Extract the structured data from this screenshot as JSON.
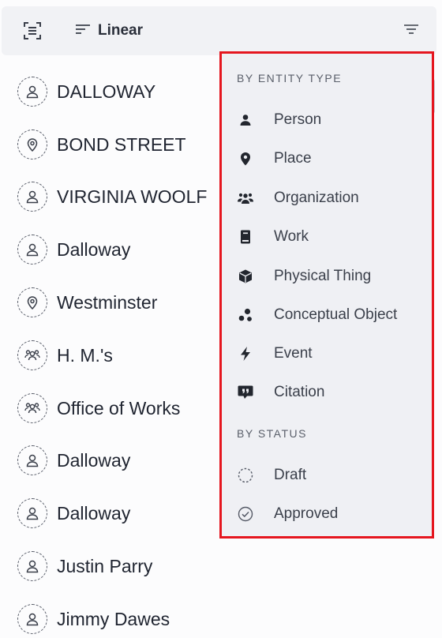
{
  "toolbar": {
    "layout_label": "Linear",
    "left_icon": "scan-text-icon",
    "sort_icon": "sort-lines-icon",
    "filter_icon": "filter-icon"
  },
  "entities": [
    {
      "label": "DALLOWAY",
      "type": "person"
    },
    {
      "label": "BOND STREET",
      "type": "place"
    },
    {
      "label": "VIRGINIA WOOLF",
      "type": "person"
    },
    {
      "label": "Dalloway",
      "type": "person"
    },
    {
      "label": "Westminster",
      "type": "place"
    },
    {
      "label": "H. M.'s",
      "type": "organization"
    },
    {
      "label": "Office of Works",
      "type": "organization"
    },
    {
      "label": "Dalloway",
      "type": "person"
    },
    {
      "label": "Dalloway",
      "type": "person"
    },
    {
      "label": "Justin Parry",
      "type": "person"
    },
    {
      "label": "Jimmy Dawes",
      "type": "person"
    }
  ],
  "filter_menu": {
    "entity_type_heading": "BY ENTITY TYPE",
    "entity_types": [
      {
        "label": "Person",
        "icon": "person-icon"
      },
      {
        "label": "Place",
        "icon": "map-pin-icon"
      },
      {
        "label": "Organization",
        "icon": "group-icon"
      },
      {
        "label": "Work",
        "icon": "book-icon"
      },
      {
        "label": "Physical Thing",
        "icon": "cube-icon"
      },
      {
        "label": "Conceptual Object",
        "icon": "dots-cluster-icon"
      },
      {
        "label": "Event",
        "icon": "lightning-icon"
      },
      {
        "label": "Citation",
        "icon": "quote-bubble-icon"
      }
    ],
    "status_heading": "BY STATUS",
    "statuses": [
      {
        "label": "Draft",
        "icon": "dashed-circle-icon"
      },
      {
        "label": "Approved",
        "icon": "check-circle-icon"
      }
    ]
  },
  "colors": {
    "highlight_border": "#e5161f",
    "menu_background": "#eff0f4",
    "toolbar_background": "#f1f2f5"
  }
}
